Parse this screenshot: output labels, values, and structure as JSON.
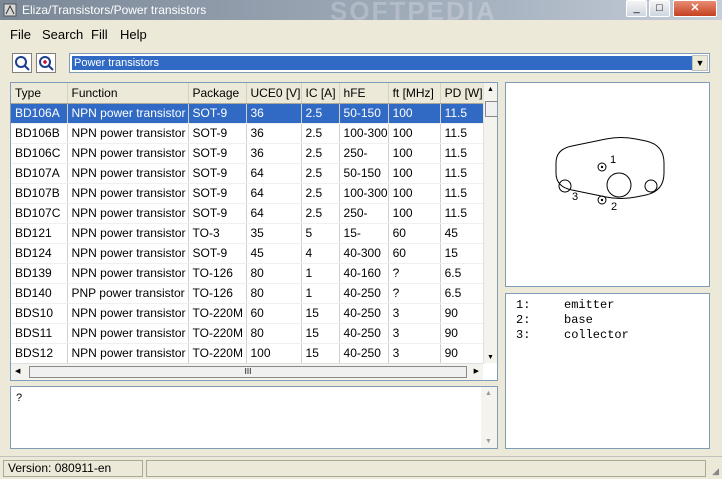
{
  "window": {
    "title": "Eliza/Transistors/Power transistors",
    "watermark": "SOFTPEDIA",
    "minimize": "_",
    "maximize": "□",
    "close": "✕"
  },
  "menu": [
    "File",
    "Search",
    "Fill",
    "Help"
  ],
  "toolbar": {
    "category_selected": "Power transistors"
  },
  "table": {
    "columns": [
      "Type",
      "Function",
      "Package",
      "UCE0 [V]",
      "IC [A]",
      "hFE",
      "ft [MHz]",
      "PD [W]"
    ],
    "rows": [
      [
        "BD106A",
        "NPN power transistor",
        "SOT-9",
        "36",
        "2.5",
        "50-150",
        "100",
        "11.5"
      ],
      [
        "BD106B",
        "NPN power transistor",
        "SOT-9",
        "36",
        "2.5",
        "100-300",
        "100",
        "11.5"
      ],
      [
        "BD106C",
        "NPN power transistor",
        "SOT-9",
        "36",
        "2.5",
        "250-",
        "100",
        "11.5"
      ],
      [
        "BD107A",
        "NPN power transistor",
        "SOT-9",
        "64",
        "2.5",
        "50-150",
        "100",
        "11.5"
      ],
      [
        "BD107B",
        "NPN power transistor",
        "SOT-9",
        "64",
        "2.5",
        "100-300",
        "100",
        "11.5"
      ],
      [
        "BD107C",
        "NPN power transistor",
        "SOT-9",
        "64",
        "2.5",
        "250-",
        "100",
        "11.5"
      ],
      [
        "BD121",
        "NPN power transistor",
        "TO-3",
        "35",
        "5",
        "15-",
        "60",
        "45"
      ],
      [
        "BD124",
        "NPN power transistor",
        "SOT-9",
        "45",
        "4",
        "40-300",
        "60",
        "15"
      ],
      [
        "BD139",
        "NPN power transistor",
        "TO-126",
        "80",
        "1",
        "40-160",
        "?",
        "6.5"
      ],
      [
        "BD140",
        "PNP power transistor",
        "TO-126",
        "80",
        "1",
        "40-250",
        "?",
        "6.5"
      ],
      [
        "BDS10",
        "NPN power transistor",
        "TO-220M",
        "60",
        "15",
        "40-250",
        "3",
        "90"
      ],
      [
        "BDS11",
        "NPN power transistor",
        "TO-220M",
        "80",
        "15",
        "40-250",
        "3",
        "90"
      ],
      [
        "BDS12",
        "NPN power transistor",
        "TO-220M",
        "100",
        "15",
        "40-250",
        "3",
        "90"
      ]
    ],
    "selected_index": 0,
    "hscroll_grip": "III"
  },
  "note": "?",
  "package_diagram": {
    "pin_labels": [
      "1",
      "2",
      "3"
    ]
  },
  "pins": [
    {
      "num": "1:",
      "name": "emitter"
    },
    {
      "num": "2:",
      "name": "base"
    },
    {
      "num": "3:",
      "name": "collector"
    }
  ],
  "status": {
    "version": "Version: 080911-en"
  },
  "colors": {
    "selection": "#316ac5",
    "panel_border": "#7f9db9"
  }
}
